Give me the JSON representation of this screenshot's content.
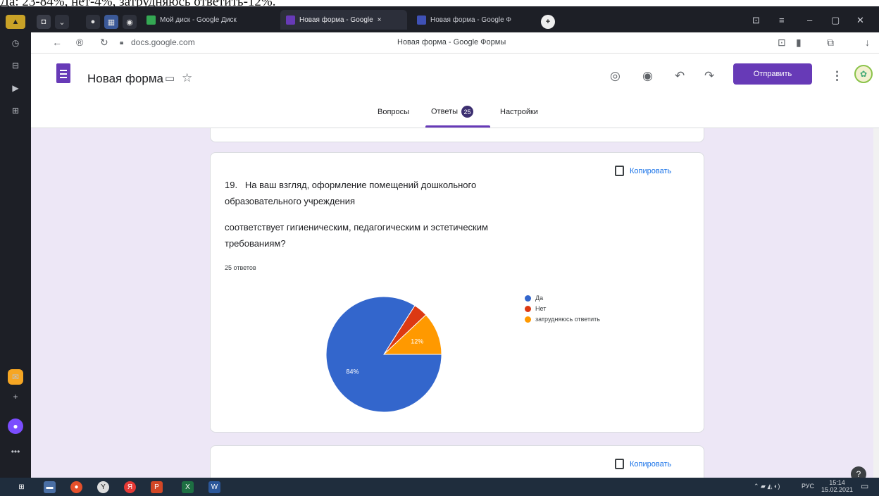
{
  "caption": "Да: 23-84%, нет-4%, затрудняюсь ответить-12%.",
  "browser": {
    "tabs": [
      {
        "label": "Мой диск - Google Диск",
        "color": "#34a853"
      },
      {
        "label": "Новая форма - Google",
        "color": "#673ab7",
        "close": "×"
      },
      {
        "label": "Новая форма - Google Ф",
        "color": "#3f51b5"
      }
    ],
    "new_tab": "+",
    "url": "docs.google.com",
    "page_title": "Новая форма - Google Формы"
  },
  "form": {
    "title": "Новая форма",
    "send_label": "Отправить",
    "nav": {
      "questions": "Вопросы",
      "answers": "Ответы",
      "answers_count": "25",
      "settings": "Настройки"
    }
  },
  "question": {
    "number": "19.",
    "text_line1": "На ваш взгляд, оформление помещений дошкольного",
    "text_line2": "образовательного учреждения",
    "text_line3": "соответствует гигиеническим, педагогическим и эстетическим",
    "text_line4": "требованиям?",
    "responses": "25 ответов",
    "copy_label": "Копировать"
  },
  "next_card": {
    "copy_label": "Копировать"
  },
  "chart_data": {
    "type": "pie",
    "labels": [
      "Да",
      "Нет",
      "затрудняюсь ответить"
    ],
    "values": [
      84,
      4,
      12
    ],
    "colors": [
      "#3366cc",
      "#dc3912",
      "#ff9900"
    ],
    "data_labels": [
      "84%",
      "",
      "12%"
    ],
    "legend_position": "right"
  },
  "taskbar": {
    "lang": "РУС",
    "time": "15:14",
    "date": "15.02.2021"
  }
}
